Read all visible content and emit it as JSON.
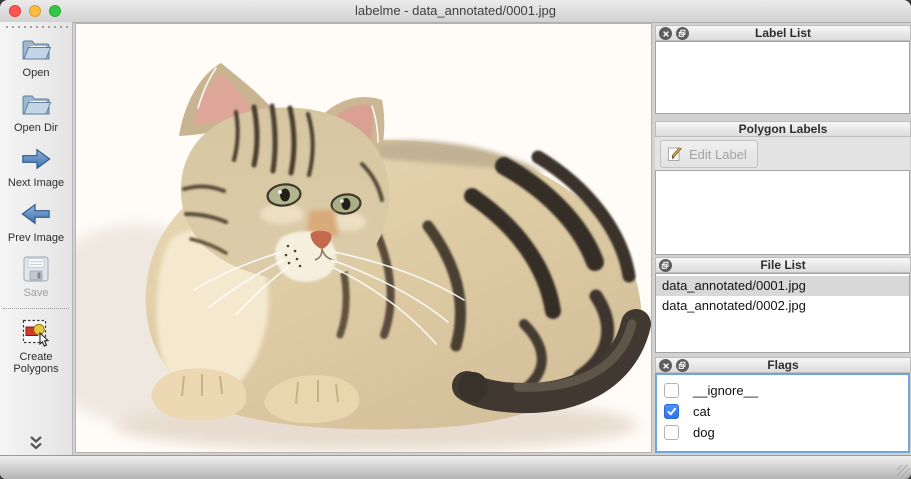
{
  "window": {
    "title": "labelme - data_annotated/0001.jpg"
  },
  "toolbar": {
    "items": [
      {
        "label": "Open",
        "icon": "folder-open-icon",
        "disabled": false
      },
      {
        "label": "Open Dir",
        "icon": "folder-open-icon",
        "disabled": false
      },
      {
        "label": "Next Image",
        "icon": "arrow-right-icon",
        "disabled": false
      },
      {
        "label": "Prev Image",
        "icon": "arrow-left-icon",
        "disabled": false
      },
      {
        "label": "Save",
        "icon": "floppy-disk-icon",
        "disabled": true
      },
      {
        "label": "Create Polygons",
        "icon": "polygon-tool-icon",
        "disabled": false
      }
    ]
  },
  "panels": {
    "label_list": {
      "title": "Label List",
      "items": []
    },
    "polygon_labels": {
      "title": "Polygon Labels",
      "edit_button_label": "Edit Label",
      "edit_button_enabled": false,
      "items": []
    },
    "file_list": {
      "title": "File List",
      "items": [
        {
          "name": "data_annotated/0001.jpg",
          "selected": true
        },
        {
          "name": "data_annotated/0002.jpg",
          "selected": false
        }
      ]
    },
    "flags": {
      "title": "Flags",
      "items": [
        {
          "label": "__ignore__",
          "checked": false
        },
        {
          "label": "cat",
          "checked": true
        },
        {
          "label": "dog",
          "checked": false
        }
      ]
    }
  },
  "canvas": {
    "image_description": "tabby kitten lying on white background"
  },
  "colors": {
    "checkbox_checked_blue": "#3b7cf7",
    "flags_focus_border": "#6fa7dd",
    "selected_row_gray": "#d8d8d8",
    "traffic_red": "#fc5753",
    "traffic_yellow": "#fdbc40",
    "traffic_green": "#33c748",
    "canvas_background": "#fffcf8"
  }
}
